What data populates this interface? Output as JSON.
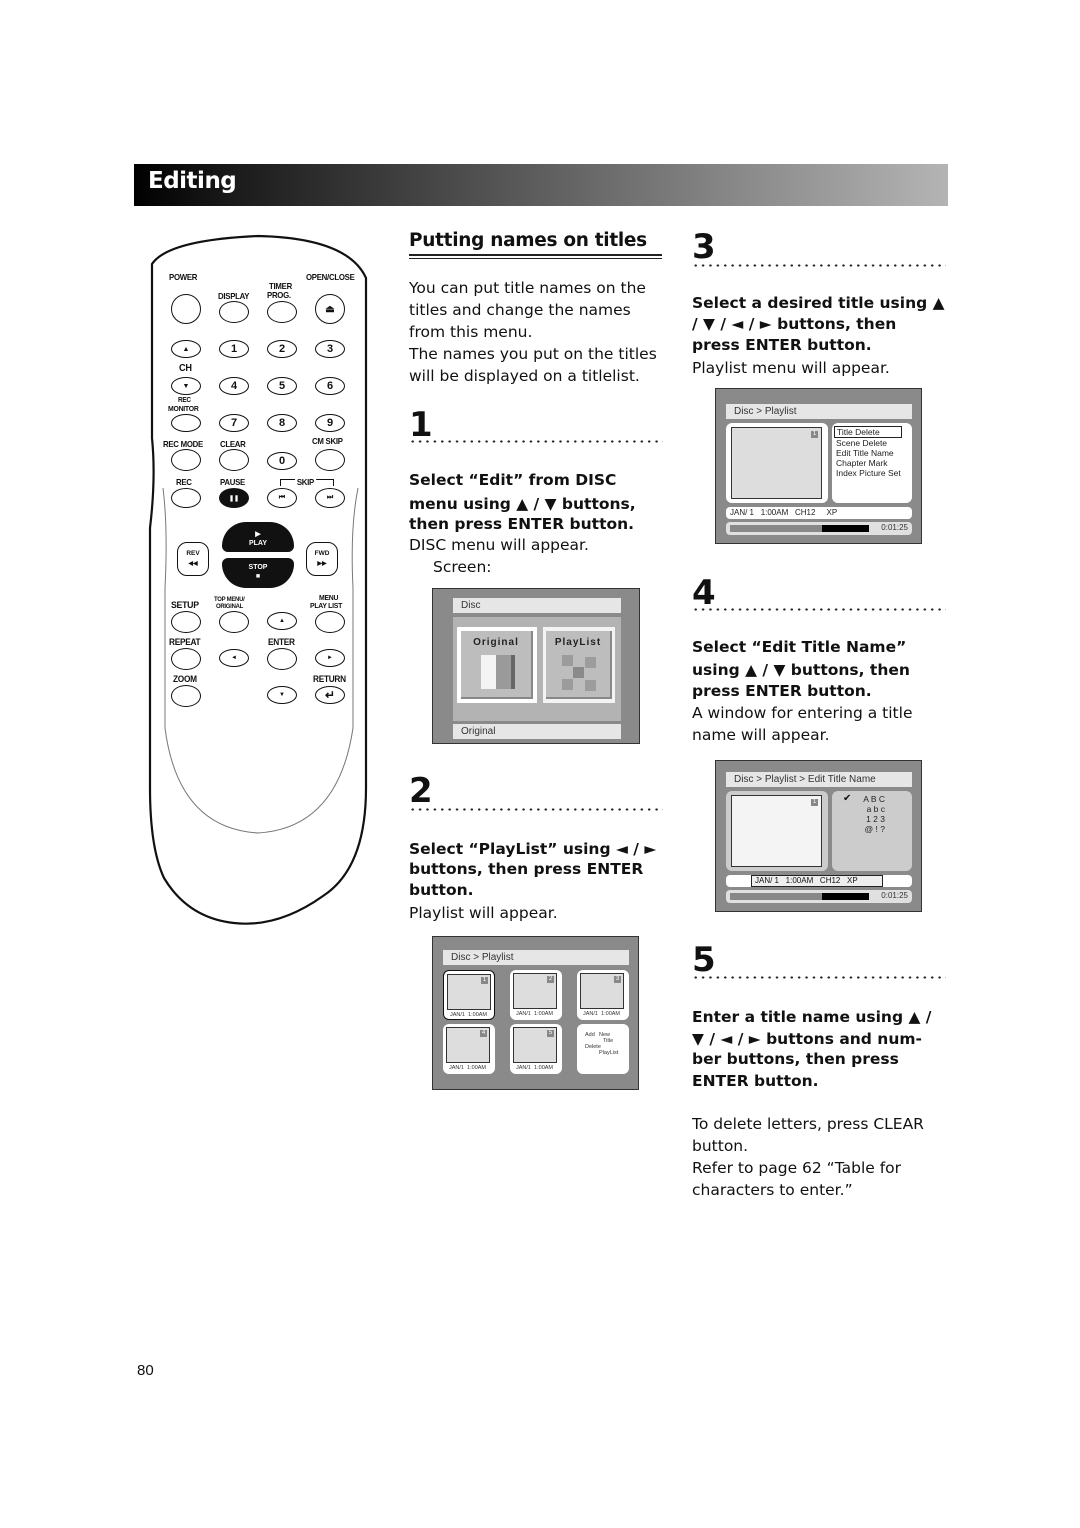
{
  "header": {
    "section_title": "Editing"
  },
  "remote": {
    "labels": {
      "power": "POWER",
      "display": "DISPLAY",
      "timer_prog_1": "TIMER",
      "timer_prog_2": "PROG.",
      "open_close": "OPEN/CLOSE",
      "ch": "CH",
      "rec_monitor_1": "REC",
      "rec_monitor_2": "MONITOR",
      "rec_mode": "REC MODE",
      "clear": "CLEAR",
      "cm_skip": "CM SKIP",
      "rec": "REC",
      "pause": "PAUSE",
      "skip": "SKIP",
      "play": "PLAY",
      "stop": "STOP",
      "rev": "REV",
      "fwd": "FWD",
      "setup": "SETUP",
      "top_menu_1": "TOP MENU/",
      "top_menu_2": "ORIGINAL",
      "menu_1": "MENU",
      "menu_2": "PLAY LIST",
      "repeat": "REPEAT",
      "enter": "ENTER",
      "zoom": "ZOOM",
      "return": "RETURN"
    },
    "digits": [
      "1",
      "2",
      "3",
      "4",
      "5",
      "6",
      "7",
      "8",
      "9",
      "0"
    ],
    "glyphs": {
      "eject": "⏏",
      "up": "▲",
      "down": "▼",
      "left": "◄",
      "right": "►",
      "pause": "❚❚",
      "skip_back": "⏮",
      "skip_fwd": "⏭",
      "play": "▶",
      "stop": "■",
      "rev": "◀◀",
      "fwd": "▶▶",
      "return": "↵"
    }
  },
  "section": {
    "title": "Putting names on titles",
    "intro_1": "You can put title names on the titles and change the names from this menu.",
    "intro_2": "The names you put on the titles will be displayed on a titlelist."
  },
  "steps": [
    {
      "number": "1",
      "instruction_1": "Select “Edit” from DISC",
      "instruction_2": "menu using ▲ / ▼ buttons,",
      "instruction_3": "then press ENTER button.",
      "result": "DISC menu will appear.",
      "note": "Screen:",
      "screen": {
        "breadcrumb": "Disc",
        "options": [
          "Original",
          "PlayList"
        ],
        "status": "Original",
        "selected": "Original"
      }
    },
    {
      "number": "2",
      "instruction_1": "Select “PlayList” using ◄ / ►",
      "instruction_2": "buttons, then press ENTER",
      "instruction_3": "button.",
      "result": "Playlist will appear.",
      "screen": {
        "breadcrumb": "Disc > Playlist",
        "titles": [
          {
            "index": "1",
            "date": "JAN/1",
            "time": "1:00AM"
          },
          {
            "index": "2",
            "date": "JAN/1",
            "time": "1:00AM"
          },
          {
            "index": "3",
            "date": "JAN/1",
            "time": "1:00AM"
          },
          {
            "index": "4",
            "date": "JAN/1",
            "time": "1:00AM"
          },
          {
            "index": "5",
            "date": "JAN/1",
            "time": "1:00AM"
          }
        ],
        "actions": {
          "add": "Add",
          "new": "New",
          "title": "Title",
          "delete": "Delete",
          "playlist": "PlayList"
        }
      }
    },
    {
      "number": "3",
      "instruction_1": "Select a desired title using ▲",
      "instruction_2": "/ ▼ / ◄ / ► buttons, then",
      "instruction_3": "press ENTER button.",
      "result": "Playlist menu will appear.",
      "screen": {
        "breadcrumb": "Disc > Playlist",
        "title_index": "1",
        "menu": [
          "Title Delete",
          "Scene Delete",
          "Edit Title Name",
          "Chapter Mark",
          "Index Picture Set"
        ],
        "selected_menu": "Title Delete",
        "info": {
          "date": "JAN/ 1",
          "time": "1:00AM",
          "channel": "CH12",
          "mode": "XP"
        },
        "progress_fraction": 0.66,
        "duration": "0:01:25"
      }
    },
    {
      "number": "4",
      "instruction_1": "Select “Edit Title Name”",
      "instruction_2": "using ▲ / ▼ buttons, then",
      "instruction_3": "press ENTER button.",
      "result": "A window for entering a title name will appear.",
      "screen": {
        "breadcrumb": "Disc > Playlist > Edit Title Name",
        "title_index": "1",
        "check": "✔",
        "char_sets": [
          "A B C",
          "a b c",
          "1 2 3",
          "@ ! ?"
        ],
        "selected_set": "A B C",
        "info": "JAN/ 1   1:00AM   CH12   XP",
        "progress_fraction": 0.66,
        "duration": "0:01:25"
      }
    },
    {
      "number": "5",
      "instruction_1": "Enter a title name using ▲ /",
      "instruction_2": "▼ / ◄ / ► buttons and num-",
      "instruction_3": "ber buttons, then press",
      "instruction_4": "ENTER button.",
      "note_1": "To delete letters, press CLEAR button.",
      "note_2": "Refer to page 62 “Table for characters to enter.”"
    }
  ],
  "footer": {
    "page_number": "80"
  }
}
